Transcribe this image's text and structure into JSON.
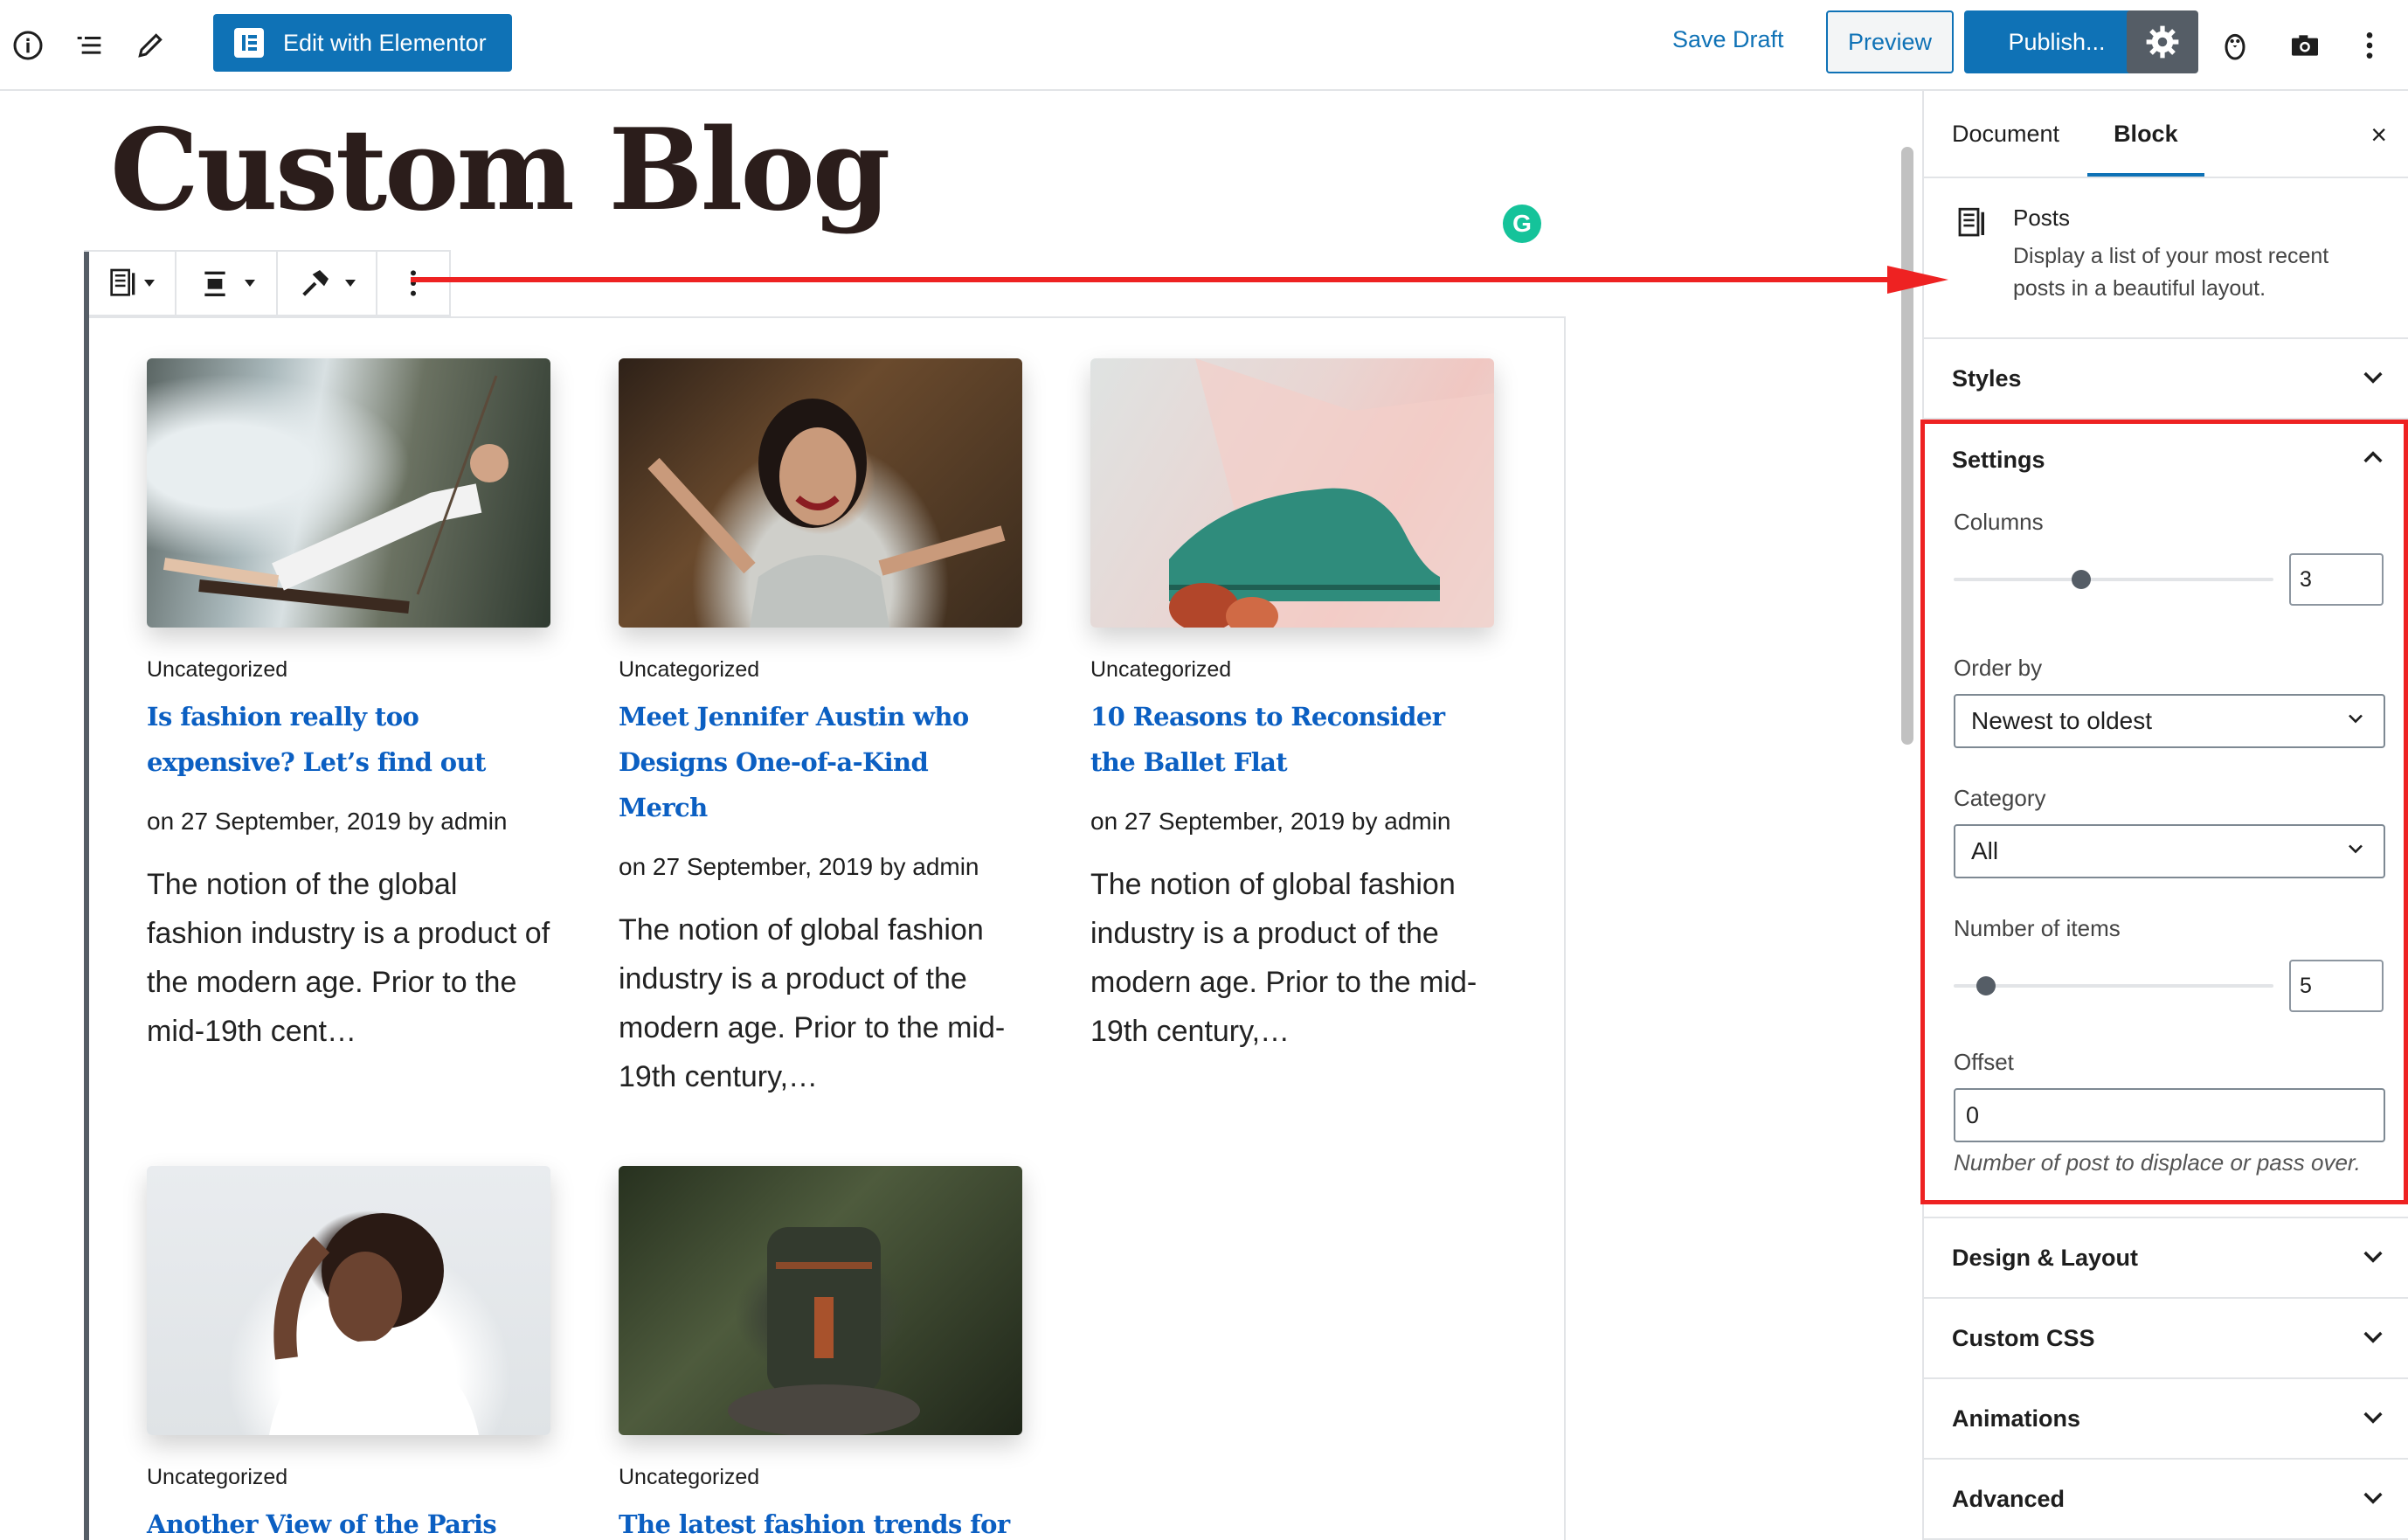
{
  "topbar": {
    "elementor_label": "Edit with Elementor",
    "save_draft": "Save Draft",
    "preview": "Preview",
    "publish": "Publish..."
  },
  "editor": {
    "post_title": "Custom Blog",
    "grammarly": "G"
  },
  "posts": [
    {
      "category": "Uncategorized",
      "title": "Is fashion really too expensive? Let’s find out",
      "meta": "on 27 September, 2019 by admin",
      "excerpt": "The notion of the global fashion industry is a product of the modern age. Prior to the mid-19th cent…"
    },
    {
      "category": "Uncategorized",
      "title": "Meet Jennifer Austin who Designs One-of-a-Kind Merch",
      "meta": "on 27 September, 2019 by admin",
      "excerpt": "The notion of global fashion industry is a product of the modern age. Prior to the mid-19th century,…"
    },
    {
      "category": "Uncategorized",
      "title": "10 Reasons to Reconsider the Ballet Flat",
      "meta": "on 27 September, 2019 by admin",
      "excerpt": "The notion of global fashion industry is a product of the modern age. Prior to the mid-19th century,…"
    },
    {
      "category": "Uncategorized",
      "title": "Another View of the Paris",
      "meta": "",
      "excerpt": ""
    },
    {
      "category": "Uncategorized",
      "title": "The latest fashion trends for",
      "meta": "",
      "excerpt": ""
    }
  ],
  "sidebar": {
    "tabs": [
      "Document",
      "Block"
    ],
    "close_icon": "×",
    "block": {
      "name": "Posts",
      "description": "Display a list of your most recent posts in a beautiful layout."
    },
    "styles_label": "Styles",
    "settings": {
      "title": "Settings",
      "columns_label": "Columns",
      "columns_value": "3",
      "columns_max": 6,
      "order_label": "Order by",
      "order_value": "Newest to oldest",
      "category_label": "Category",
      "category_value": "All",
      "items_label": "Number of items",
      "items_value": "5",
      "items_max": 100,
      "offset_label": "Offset",
      "offset_value": "0",
      "offset_help": "Number of post to displace or pass over."
    },
    "panels": [
      "Design & Layout",
      "Custom CSS",
      "Animations",
      "Advanced"
    ]
  },
  "colors": {
    "accent": "#0f72b6",
    "post_title_link": "#0b5fc2",
    "annotation": "#ee2222",
    "grammarly": "#15c39a"
  }
}
